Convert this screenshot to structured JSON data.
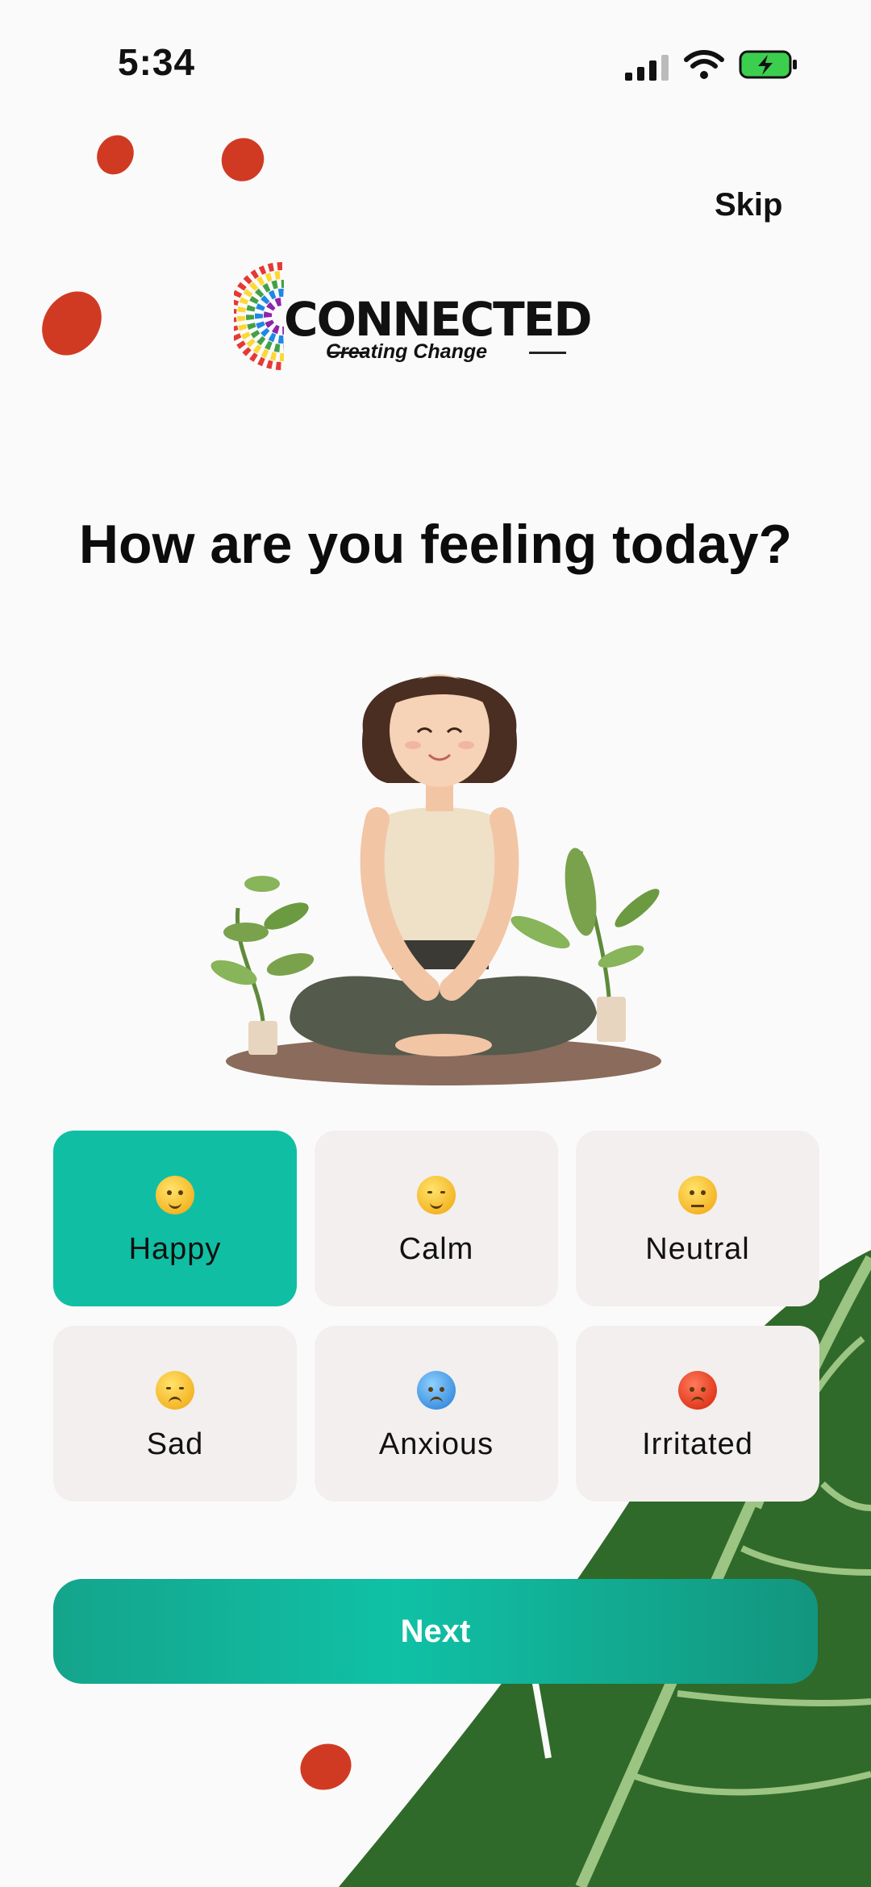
{
  "status_bar": {
    "time": "5:34"
  },
  "header": {
    "skip_label": "Skip"
  },
  "logo": {
    "title": "CONNECTED",
    "subtitle": "Creating Change"
  },
  "main": {
    "heading": "How are you feeling today?"
  },
  "moods": [
    {
      "label": "Happy",
      "icon": "happy-face-icon",
      "selected": true
    },
    {
      "label": "Calm",
      "icon": "relieved-face-icon",
      "selected": false
    },
    {
      "label": "Neutral",
      "icon": "neutral-face-icon",
      "selected": false
    },
    {
      "label": "Sad",
      "icon": "pensive-face-icon",
      "selected": false
    },
    {
      "label": "Anxious",
      "icon": "anxious-face-icon",
      "selected": false
    },
    {
      "label": "Irritated",
      "icon": "angry-face-icon",
      "selected": false
    }
  ],
  "footer": {
    "next_label": "Next"
  },
  "colors": {
    "accent": "#10bfa3",
    "card_bg": "#f2efee",
    "blob": "#d03a23",
    "leaf": "#2f6a2a"
  }
}
